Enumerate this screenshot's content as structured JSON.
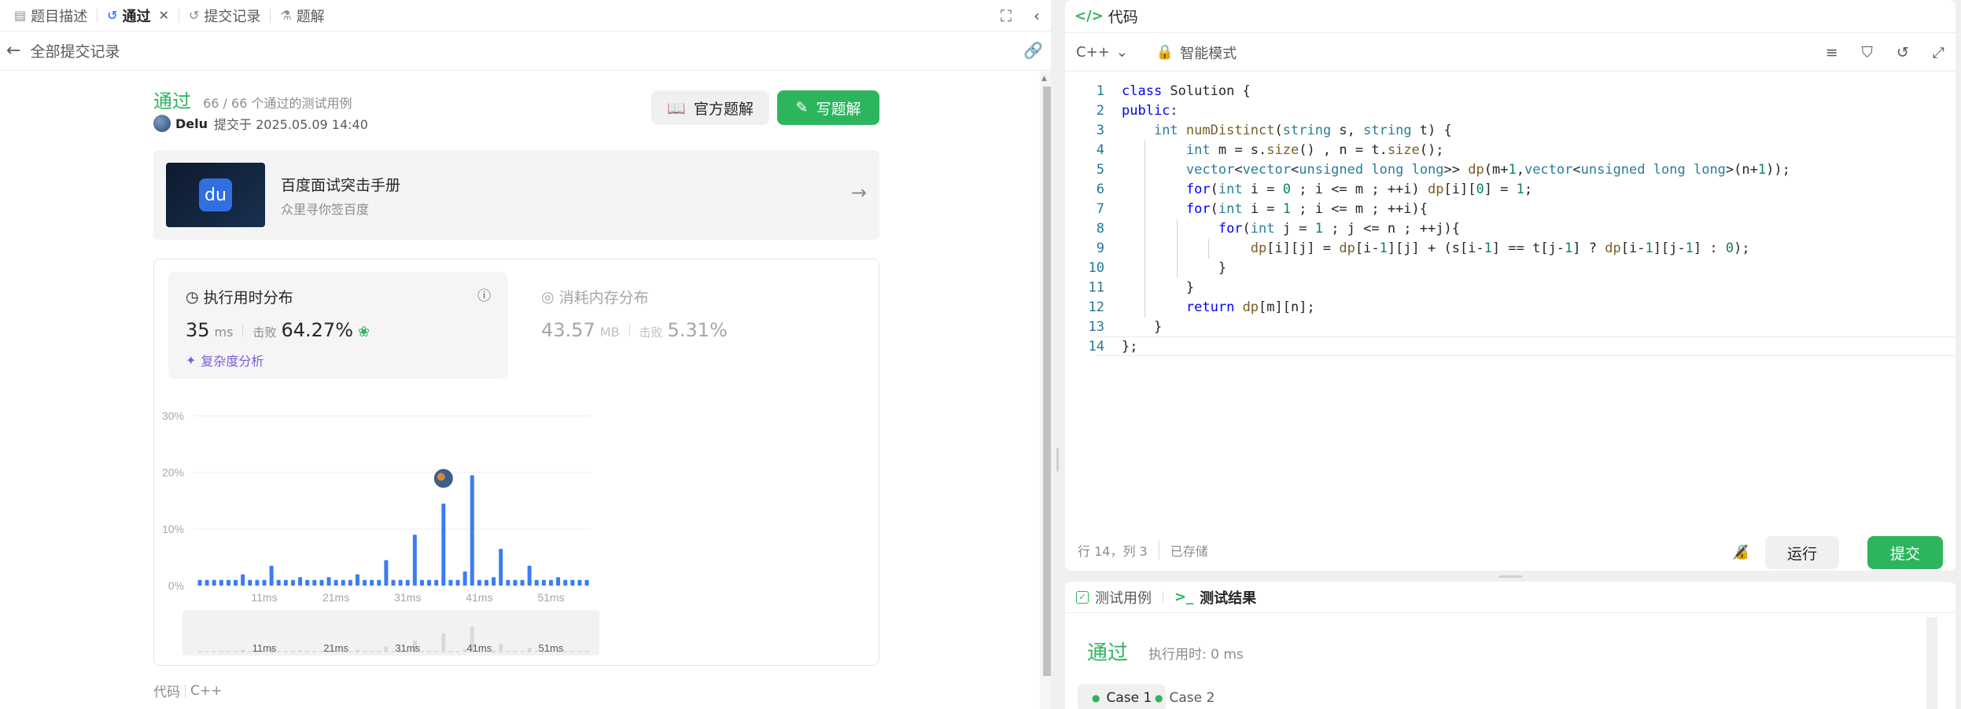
{
  "left_tabs": [
    {
      "label": "题目描述",
      "icon": "document-icon"
    },
    {
      "label": "通过",
      "icon": "history-icon",
      "active": true
    },
    {
      "label": "提交记录",
      "icon": "history-icon"
    },
    {
      "label": "题解",
      "icon": "flask-icon"
    }
  ],
  "back_label": "全部提交记录",
  "submission": {
    "status": "通过",
    "passed_cases": "66 / 66 个通过的测试用例",
    "author": "Delu",
    "submitted_at": "提交于 2025.05.09 14:40"
  },
  "buttons": {
    "official": "官方题解",
    "write": "写题解"
  },
  "promo": {
    "title": "百度面试突击手册",
    "subtitle": "众里寻你签百度",
    "logo_text": "du"
  },
  "runtime": {
    "title": "执行用时分布",
    "value": "35",
    "unit": "ms",
    "beat_label": "击败",
    "beat_pct": "64.27%",
    "complexity_link": "复杂度分析"
  },
  "memory": {
    "title": "消耗内存分布",
    "value": "43.57",
    "unit": "MB",
    "beat_label": "击败",
    "beat_pct": "5.31%"
  },
  "chart_data": {
    "type": "bar",
    "ylabel_ticks": [
      "30%",
      "20%",
      "10%",
      "0%"
    ],
    "ylim": [
      0,
      30
    ],
    "x_tick_labels": [
      "11ms",
      "21ms",
      "31ms",
      "41ms",
      "51ms"
    ],
    "x_tick_values": [
      11,
      21,
      31,
      41,
      51
    ],
    "x_start": 2,
    "x_end": 56,
    "values": [
      1,
      1,
      1,
      1,
      1,
      1,
      2,
      1,
      1,
      1,
      3.5,
      1,
      1,
      1,
      1.5,
      1,
      1,
      1,
      1.5,
      1,
      1,
      1,
      2,
      1,
      1,
      1,
      4.5,
      1,
      1,
      1,
      9,
      1,
      1,
      1,
      14.5,
      1,
      1,
      2.5,
      19.5,
      1,
      1,
      1.5,
      6.5,
      1,
      1,
      1,
      3.5,
      1,
      1,
      1,
      1.5,
      1,
      1,
      1,
      1
    ],
    "highlight_index": 34,
    "grid": true,
    "colors": {
      "bar": "#3b7cf6",
      "mini": "#d9d9d9"
    }
  },
  "code_lang_label": "代码",
  "code_lang": "C++",
  "editor": {
    "header": "代码",
    "language": "C++",
    "mode": "智能模式",
    "lines": [
      "class Solution {",
      "public:",
      "    int numDistinct(string s, string t) {",
      "        int m = s.size() , n = t.size();",
      "        vector<vector<unsigned long long>> dp(m+1,vector<unsigned long long>(n+1));",
      "        for(int i = 0 ; i <= m ; ++i) dp[i][0] = 1;",
      "        for(int i = 1 ; i <= m ; ++i){",
      "            for(int j = 1 ; j <= n ; ++j){",
      "                dp[i][j] = dp[i-1][j] + (s[i-1] == t[j-1] ? dp[i-1][j-1] : 0);",
      "            }",
      "        }",
      "        return dp[m][n];",
      "    }",
      "};"
    ],
    "cursor_pos": "行 14，列 3",
    "saved": "已存储",
    "run": "运行",
    "submit": "提交"
  },
  "bottom_panel": {
    "tab_cases": "测试用例",
    "tab_result": "测试结果",
    "status": "通过",
    "time": "执行用时: 0 ms",
    "cases": [
      "Case 1",
      "Case 2"
    ]
  }
}
